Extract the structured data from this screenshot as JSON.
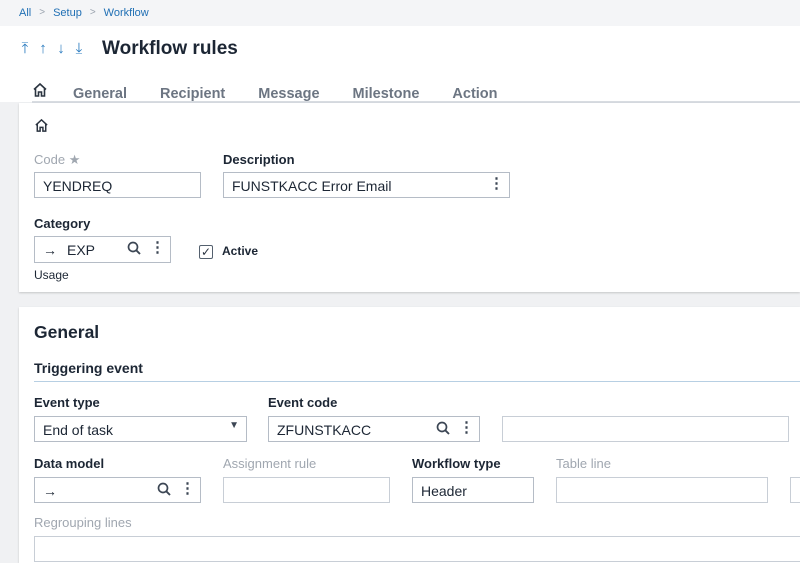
{
  "breadcrumb": [
    "All",
    "Setup",
    "Workflow"
  ],
  "page_title": "Workflow rules",
  "tabs": [
    "General",
    "Recipient",
    "Message",
    "Milestone",
    "Action"
  ],
  "header_card": {
    "code_label": "Code",
    "code_value": "YENDREQ",
    "description_label": "Description",
    "description_value": "FUNSTKACC Error Email",
    "category_label": "Category",
    "category_value": "EXP",
    "active_label": "Active",
    "active_checked": true,
    "usage_label": "Usage"
  },
  "general": {
    "title": "General",
    "triggering_event": "Triggering event",
    "event_type_label": "Event type",
    "event_type_value": "End of task",
    "event_code_label": "Event code",
    "event_code_value": "ZFUNSTKACC",
    "data_model_label": "Data model",
    "assignment_rule_label": "Assignment rule",
    "workflow_type_label": "Workflow type",
    "workflow_type_value": "Header",
    "table_line_label": "Table line",
    "regrouping_lines_label": "Regrouping lines"
  }
}
